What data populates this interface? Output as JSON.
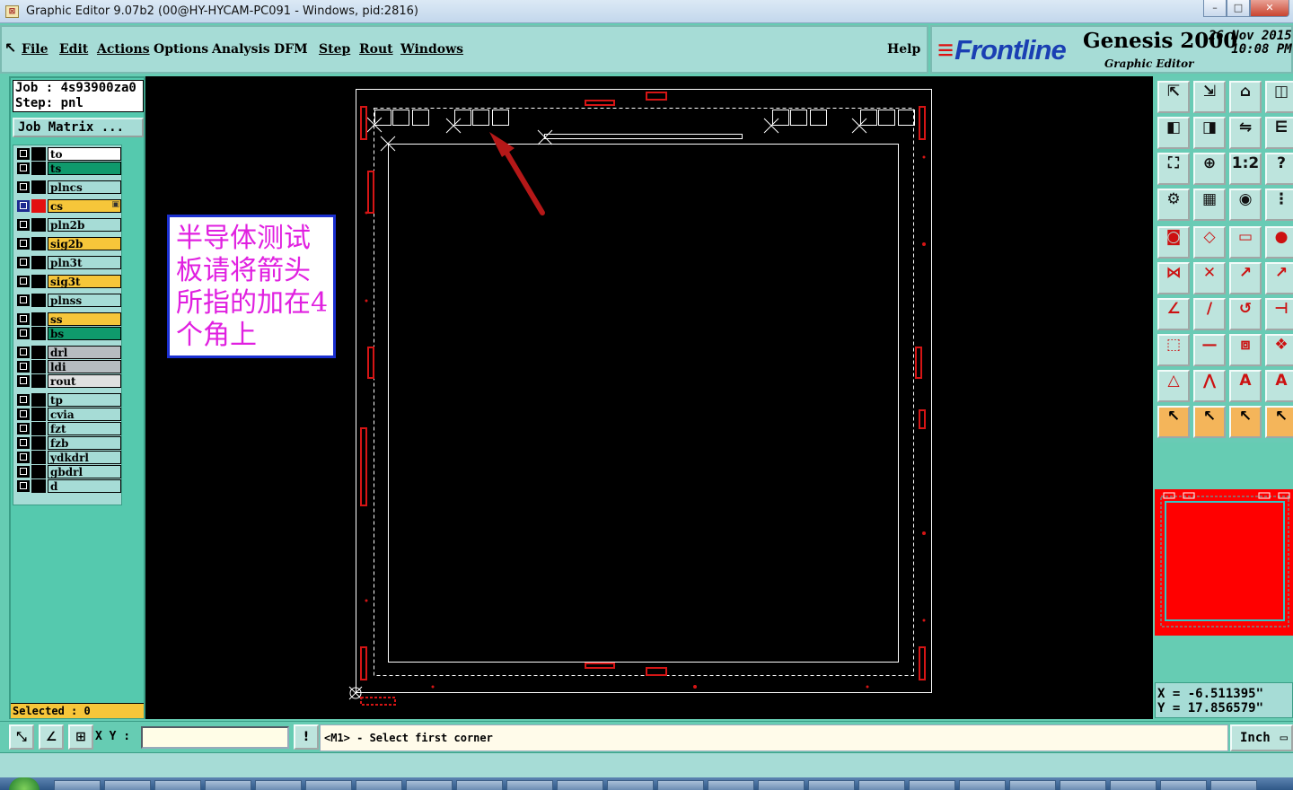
{
  "window": {
    "title": "Graphic Editor 9.07b2 (00@HY-HYCAM-PC091 - Windows, pid:2816)",
    "app_icon": "graphic-editor-icon",
    "controls": [
      "minimize-icon",
      "maximize-icon",
      "close-icon"
    ]
  },
  "menubar": {
    "items": [
      "File",
      "Edit",
      "Actions",
      "Options",
      "Analysis",
      "DFM",
      "Step",
      "Rout",
      "Windows"
    ],
    "help": "Help"
  },
  "brand": {
    "logo": "Frontline",
    "product": "Genesis 2000",
    "subtitle": "Graphic Editor",
    "date": "26 Nov 2015",
    "time": "10:08 PM"
  },
  "job": {
    "job_line": "Job : 4s93900za0",
    "step_line": "Step: pnl",
    "matrix_button": "Job Matrix ..."
  },
  "layers": [
    {
      "name": "to",
      "color": "#ffffff"
    },
    {
      "name": "ts",
      "color": "#0f9a6c"
    },
    {
      "name": "plncs",
      "color": "#a6dcd6"
    },
    {
      "name": "cs",
      "color": "#f6c63a",
      "active": true
    },
    {
      "name": "pln2b",
      "color": "#a6dcd6"
    },
    {
      "name": "sig2b",
      "color": "#f6c63a"
    },
    {
      "name": "pln3t",
      "color": "#a6dcd6"
    },
    {
      "name": "sig3t",
      "color": "#f6c63a"
    },
    {
      "name": "plnss",
      "color": "#a6dcd6"
    },
    {
      "name": "ss",
      "color": "#f6c63a"
    },
    {
      "name": "bs",
      "color": "#0f9a6c"
    },
    {
      "name": "drl",
      "color": "#b6bcc0"
    },
    {
      "name": "ldi",
      "color": "#b6bcc0"
    },
    {
      "name": "rout",
      "color": "#e0e0e0"
    },
    {
      "name": "tp",
      "color": "#a6dcd6"
    },
    {
      "name": "cvia",
      "color": "#a6dcd6"
    },
    {
      "name": "fzt",
      "color": "#a6dcd6"
    },
    {
      "name": "fzb",
      "color": "#a6dcd6"
    },
    {
      "name": "ydkdrl",
      "color": "#a6dcd6"
    },
    {
      "name": "gbdrl",
      "color": "#a6dcd6"
    },
    {
      "name": "d",
      "color": "#a6dcd6"
    }
  ],
  "selected_text": "Selected : 0",
  "annotation": {
    "text": "半导体测试板请将箭头所指的加在4个角上",
    "text_color": "#e020e0"
  },
  "coords": {
    "x_line": "X = -6.511395\"",
    "y_line": "Y = 17.856579\""
  },
  "status": {
    "xy_label": "X Y :",
    "xy_value": "",
    "prompt": "<M1> - Select first corner",
    "unit": "Inch"
  },
  "colors": {
    "panel": "#66ccb3",
    "outline_red": "#d61515",
    "board_line": "#ffffff",
    "preview_fill": "#ff0000"
  },
  "tools": [
    "zoom-home-icon",
    "zoom-in-icon",
    "home-icon",
    "split-view-icon",
    "pan-left-icon",
    "pan-right-icon",
    "flip-icon",
    "snap-icon",
    "fit-icon",
    "center-icon",
    "scale-icon",
    "query-icon",
    "settings-icon",
    "grid-icon",
    "layer-compare-icon",
    "layer-list-icon",
    "pad-icon",
    "surface-icon",
    "measure-icon",
    "drill-icon",
    "net-icon",
    "cross-icon",
    "connect-icon",
    "route-icon",
    "angle-icon",
    "line-icon",
    "arc-icon",
    "text-icon",
    "node-icon",
    "dash-icon",
    "select-box-icon",
    "group-icon",
    "triangle-icon",
    "peak-icon",
    "a-icon",
    "a2-icon",
    "pointer-icon",
    "pointer-box-icon",
    "pointer-circle-icon",
    "pointer-net-icon"
  ]
}
